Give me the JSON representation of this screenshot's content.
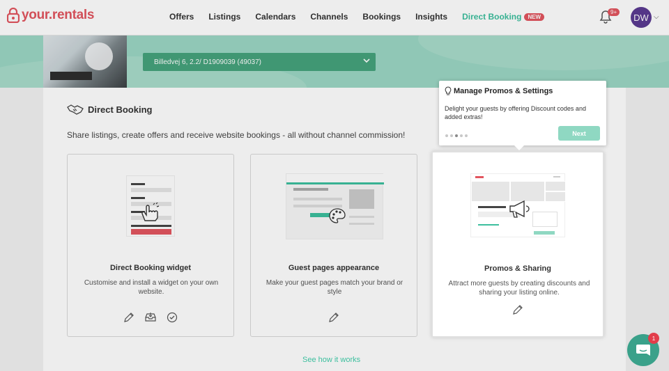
{
  "brand": {
    "name": "your.rentals",
    "accent": "#e2555f",
    "green": "#3cbf9e"
  },
  "nav": {
    "items": [
      {
        "label": "Offers"
      },
      {
        "label": "Listings"
      },
      {
        "label": "Calendars"
      },
      {
        "label": "Channels"
      },
      {
        "label": "Bookings"
      },
      {
        "label": "Insights"
      }
    ],
    "active": {
      "label": "Direct Booking",
      "badge": "NEW"
    },
    "notifications": "9+",
    "avatar_initials": "DW"
  },
  "listing_select": {
    "value": "Billedvej 6, 2.2/ D1909039 (49037)"
  },
  "section": {
    "title": "Direct Booking",
    "description": "Share listings, create offers and receive website bookings - all without channel commission!"
  },
  "features": [
    {
      "title": "Direct Booking widget",
      "desc": "Customise and install a widget on your own website.",
      "icons": [
        "pencil-icon",
        "inbox-icon",
        "check-circle-icon"
      ]
    },
    {
      "title": "Guest pages appearance",
      "desc": "Make your guest pages match your brand or style",
      "icons": [
        "pencil-icon"
      ]
    },
    {
      "title": "Promos & Sharing",
      "desc": "Attract more guests by creating discounts and sharing your listing online.",
      "icons": [
        "pencil-icon"
      ]
    }
  ],
  "see_how": "See how it works",
  "tooltip": {
    "title": "Manage Promos & Settings",
    "body": "Delight your guests by offering Discount codes and added extras!",
    "next_label": "Next",
    "step": 3,
    "total_steps": 5
  },
  "chat": {
    "badge": "1"
  }
}
